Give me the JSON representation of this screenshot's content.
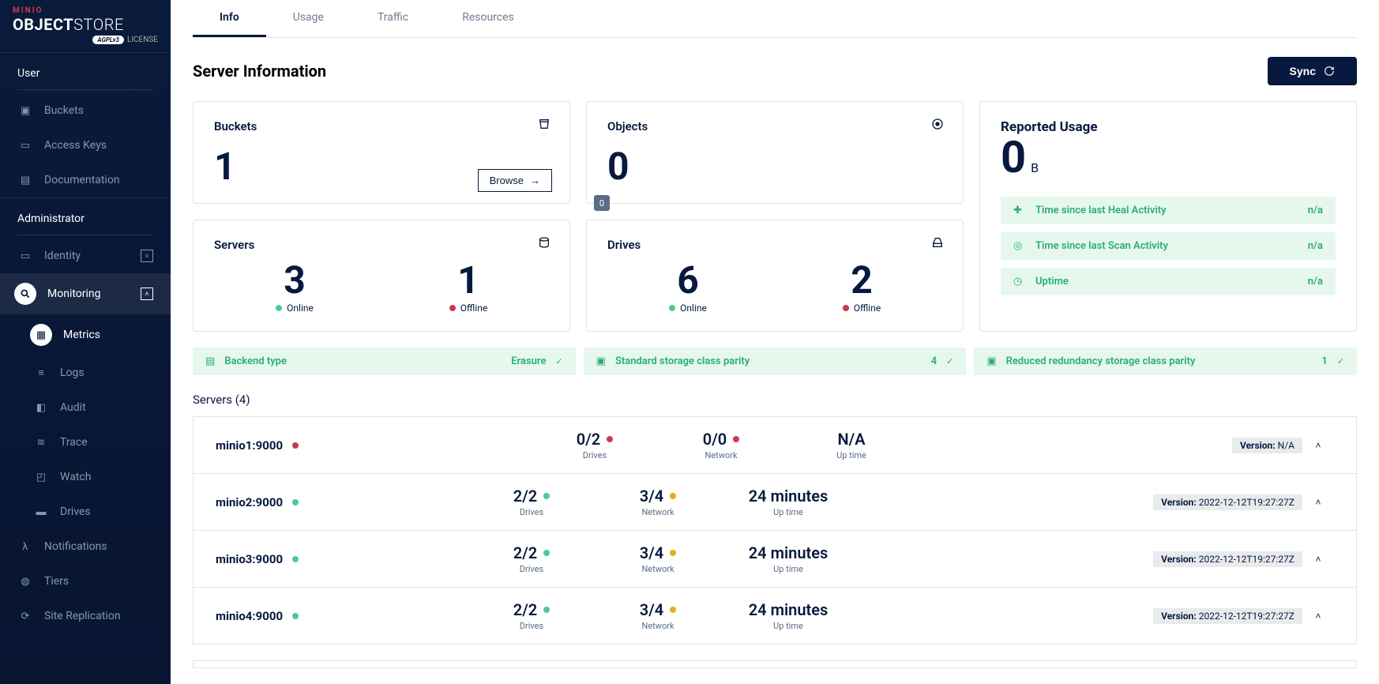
{
  "brand": {
    "top": "MINIO",
    "main1": "OBJECT",
    "main2": "STORE",
    "license_tag": "AGPLv3",
    "license": "LICENSE"
  },
  "sidebar": {
    "sections": {
      "user": {
        "label": "User",
        "items": [
          {
            "label": "Buckets",
            "icon": "bucket"
          },
          {
            "label": "Access Keys",
            "icon": "id"
          },
          {
            "label": "Documentation",
            "icon": "doc"
          }
        ]
      },
      "admin": {
        "label": "Administrator",
        "items": [
          {
            "label": "Identity",
            "icon": "id-card",
            "chev": "down"
          },
          {
            "label": "Monitoring",
            "icon": "magnify",
            "chev": "up",
            "active": true,
            "sub": [
              {
                "label": "Metrics",
                "active": true,
                "icon": "grid"
              },
              {
                "label": "Logs",
                "icon": "logs"
              },
              {
                "label": "Audit",
                "icon": "audit"
              },
              {
                "label": "Trace",
                "icon": "trace"
              },
              {
                "label": "Watch",
                "icon": "watch"
              },
              {
                "label": "Drives",
                "icon": "drives"
              }
            ]
          },
          {
            "label": "Notifications",
            "icon": "lambda"
          },
          {
            "label": "Tiers",
            "icon": "tiers"
          },
          {
            "label": "Site Replication",
            "icon": "repl"
          }
        ]
      }
    }
  },
  "tabs": [
    {
      "label": "Info",
      "active": true
    },
    {
      "label": "Usage"
    },
    {
      "label": "Traffic"
    },
    {
      "label": "Resources"
    }
  ],
  "page": {
    "title": "Server Information",
    "sync": "Sync"
  },
  "cards": {
    "buckets": {
      "label": "Buckets",
      "value": "1",
      "browse": "Browse"
    },
    "objects": {
      "label": "Objects",
      "value": "0"
    },
    "servers": {
      "label": "Servers",
      "online": "3",
      "online_label": "Online",
      "offline": "1",
      "offline_label": "Offline"
    },
    "drives": {
      "label": "Drives",
      "online": "6",
      "online_label": "Online",
      "offline": "2",
      "offline_label": "Offline"
    },
    "usage": {
      "label": "Reported Usage",
      "value": "0",
      "unit": "B",
      "rows": [
        {
          "label": "Time since last Heal Activity",
          "value": "n/a"
        },
        {
          "label": "Time since last Scan Activity",
          "value": "n/a"
        },
        {
          "label": "Uptime",
          "value": "n/a"
        }
      ]
    }
  },
  "strips": [
    {
      "label": "Backend type",
      "value": "Erasure"
    },
    {
      "label": "Standard storage class parity",
      "value": "4"
    },
    {
      "label": "Reduced redundancy storage class parity",
      "value": "1"
    }
  ],
  "servers": {
    "heading_prefix": "Servers",
    "count": "4",
    "cols": {
      "drives": "Drives",
      "network": "Network",
      "uptime": "Up time",
      "version": "Version:"
    },
    "rows": [
      {
        "name": "minio1:9000",
        "status": "red",
        "drives": "0/2",
        "ddot": "red",
        "network": "0/0",
        "ndot": "red",
        "uptime": "N/A",
        "version": "N/A"
      },
      {
        "name": "minio2:9000",
        "status": "green",
        "drives": "2/2",
        "ddot": "green",
        "network": "3/4",
        "ndot": "orange",
        "uptime": "24 minutes",
        "version": "2022-12-12T19:27:27Z"
      },
      {
        "name": "minio3:9000",
        "status": "green",
        "drives": "2/2",
        "ddot": "green",
        "network": "3/4",
        "ndot": "orange",
        "uptime": "24 minutes",
        "version": "2022-12-12T19:27:27Z"
      },
      {
        "name": "minio4:9000",
        "status": "green",
        "drives": "2/2",
        "ddot": "green",
        "network": "3/4",
        "ndot": "orange",
        "uptime": "24 minutes",
        "version": "2022-12-12T19:27:27Z"
      }
    ]
  },
  "notif_badge": "0"
}
